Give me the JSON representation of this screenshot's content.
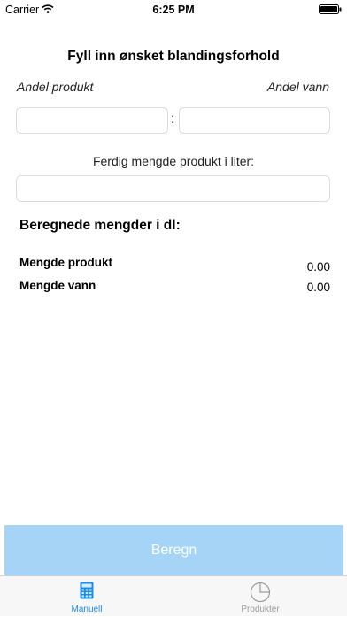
{
  "status_bar": {
    "carrier": "Carrier",
    "time": "6:25 PM"
  },
  "form": {
    "title": "Fyll inn ønsket blandingsforhold",
    "product_share_label": "Andel produkt",
    "water_share_label": "Andel vann",
    "ratio_separator": ":",
    "product_share_value": "",
    "water_share_value": "",
    "amount_label": "Ferdig mengde produkt i liter:",
    "amount_value": ""
  },
  "results": {
    "title": "Beregnede mengder i dl:",
    "rows": [
      {
        "label": "Mengde produkt",
        "value": "0.00"
      },
      {
        "label": "Mengde vann",
        "value": "0.00"
      }
    ]
  },
  "calculate_button": {
    "label": "Beregn",
    "color": "#a5d4f7"
  },
  "tab_bar": {
    "tabs": [
      {
        "label": "Manuell",
        "icon": "calculator-icon",
        "active": true,
        "color": "#1a8cf0"
      },
      {
        "label": "Produkter",
        "icon": "pie-chart-icon",
        "active": false,
        "color": "#9b9b9b"
      }
    ]
  }
}
